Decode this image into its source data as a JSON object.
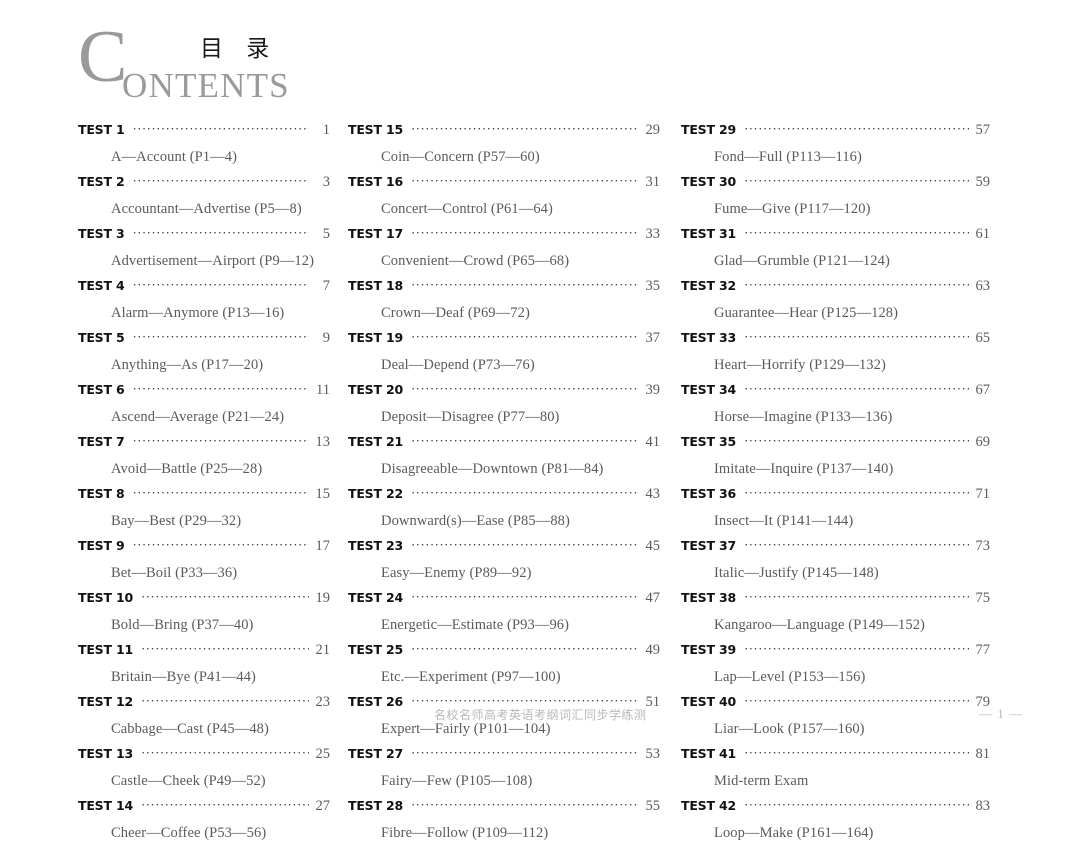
{
  "header": {
    "drop_cap": "C",
    "rest": "ONTENTS",
    "chinese_title": "目 录"
  },
  "columns": [
    {
      "name": "column-1",
      "entries": [
        {
          "label": "TEST 1",
          "page": "1",
          "sub": "A—Account (P1—4)"
        },
        {
          "label": "TEST 2",
          "page": "3",
          "sub": "Accountant—Advertise (P5—8)"
        },
        {
          "label": "TEST 3",
          "page": "5",
          "sub": "Advertisement—Airport (P9—12)"
        },
        {
          "label": "TEST 4",
          "page": "7",
          "sub": "Alarm—Anymore (P13—16)"
        },
        {
          "label": "TEST 5",
          "page": "9",
          "sub": "Anything—As (P17—20)"
        },
        {
          "label": "TEST 6",
          "page": "11",
          "sub": "Ascend—Average (P21—24)"
        },
        {
          "label": "TEST 7",
          "page": "13",
          "sub": "Avoid—Battle (P25—28)"
        },
        {
          "label": "TEST 8",
          "page": "15",
          "sub": "Bay—Best (P29—32)"
        },
        {
          "label": "TEST 9",
          "page": "17",
          "sub": "Bet—Boil (P33—36)"
        },
        {
          "label": "TEST 10",
          "page": "19",
          "sub": "Bold—Bring (P37—40)"
        },
        {
          "label": "TEST 11",
          "page": "21",
          "sub": "Britain—Bye (P41—44)"
        },
        {
          "label": "TEST 12",
          "page": "23",
          "sub": "Cabbage—Cast (P45—48)"
        },
        {
          "label": "TEST 13",
          "page": "25",
          "sub": "Castle—Cheek (P49—52)"
        },
        {
          "label": "TEST 14",
          "page": "27",
          "sub": "Cheer—Coffee (P53—56)"
        }
      ]
    },
    {
      "name": "column-2",
      "entries": [
        {
          "label": "TEST 15",
          "page": "29",
          "sub": "Coin—Concern (P57—60)"
        },
        {
          "label": "TEST 16",
          "page": "31",
          "sub": "Concert—Control (P61—64)"
        },
        {
          "label": "TEST 17",
          "page": "33",
          "sub": "Convenient—Crowd (P65—68)"
        },
        {
          "label": "TEST 18",
          "page": "35",
          "sub": "Crown—Deaf (P69—72)"
        },
        {
          "label": "TEST 19",
          "page": "37",
          "sub": "Deal—Depend (P73—76)"
        },
        {
          "label": "TEST 20",
          "page": "39",
          "sub": "Deposit—Disagree (P77—80)"
        },
        {
          "label": "TEST 21",
          "page": "41",
          "sub": "Disagreeable—Downtown (P81—84)"
        },
        {
          "label": "TEST 22",
          "page": "43",
          "sub": "Downward(s)—Ease (P85—88)"
        },
        {
          "label": "TEST 23",
          "page": "45",
          "sub": "Easy—Enemy (P89—92)"
        },
        {
          "label": "TEST 24",
          "page": "47",
          "sub": "Energetic—Estimate (P93—96)"
        },
        {
          "label": "TEST 25",
          "page": "49",
          "sub": "Etc.—Experiment (P97—100)"
        },
        {
          "label": "TEST 26",
          "page": "51",
          "sub": "Expert—Fairly (P101—104)"
        },
        {
          "label": "TEST 27",
          "page": "53",
          "sub": "Fairy—Few (P105—108)"
        },
        {
          "label": "TEST 28",
          "page": "55",
          "sub": "Fibre—Follow (P109—112)"
        }
      ]
    },
    {
      "name": "column-3",
      "entries": [
        {
          "label": "TEST 29",
          "page": "57",
          "sub": "Fond—Full (P113—116)"
        },
        {
          "label": "TEST 30",
          "page": "59",
          "sub": "Fume—Give (P117—120)"
        },
        {
          "label": "TEST 31",
          "page": "61",
          "sub": "Glad—Grumble (P121—124)"
        },
        {
          "label": "TEST 32",
          "page": "63",
          "sub": "Guarantee—Hear (P125—128)"
        },
        {
          "label": "TEST 33",
          "page": "65",
          "sub": "Heart—Horrify (P129—132)"
        },
        {
          "label": "TEST 34",
          "page": "67",
          "sub": "Horse—Imagine (P133—136)"
        },
        {
          "label": "TEST 35",
          "page": "69",
          "sub": "Imitate—Inquire (P137—140)"
        },
        {
          "label": "TEST 36",
          "page": "71",
          "sub": "Insect—It (P141—144)"
        },
        {
          "label": "TEST 37",
          "page": "73",
          "sub": "Italic—Justify (P145—148)"
        },
        {
          "label": "TEST 38",
          "page": "75",
          "sub": "Kangaroo—Language (P149—152)"
        },
        {
          "label": "TEST 39",
          "page": "77",
          "sub": "Lap—Level (P153—156)"
        },
        {
          "label": "TEST 40",
          "page": "79",
          "sub": "Liar—Look (P157—160)"
        },
        {
          "label": "TEST 41",
          "page": "81",
          "sub": "Mid-term Exam"
        },
        {
          "label": "TEST 42",
          "page": "83",
          "sub": "Loop—Make (P161—164)"
        }
      ]
    }
  ],
  "footer": {
    "book_title": "名校名师高考英语考纲词汇同步学练测",
    "page_marker": "— 1 —"
  },
  "colors": {
    "heading_gray": "#9a9a9a",
    "body_gray": "#5a5a5a",
    "label_black": "#111111",
    "footer_gray": "#b9b9b9"
  }
}
